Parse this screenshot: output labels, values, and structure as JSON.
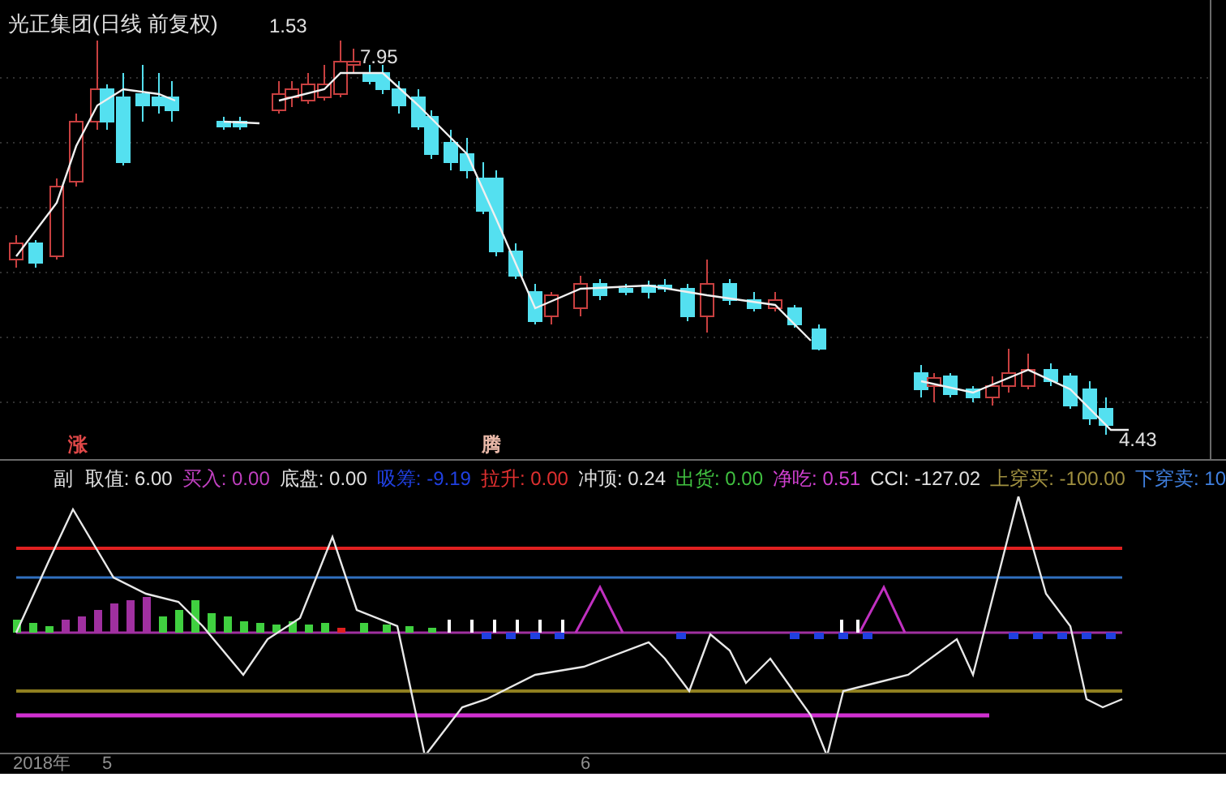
{
  "chart_title": "光正集团(日线 前复权)",
  "price_reading": "1.53",
  "high_label": "7.95",
  "low_label": "4.43",
  "markers": [
    {
      "text": "涨",
      "color": "#e04848"
    },
    {
      "text": "腾",
      "color": "#e8b8a8"
    }
  ],
  "indicator": {
    "name": "副",
    "readings": [
      {
        "text": "取值: 6.00",
        "color": "#e0e0e0"
      },
      {
        "text": "买入: 0.00",
        "color": "#c040c0"
      },
      {
        "text": "底盘: 0.00",
        "color": "#e0e0e0"
      },
      {
        "text": "吸筹: -9.19",
        "color": "#2040e0"
      },
      {
        "text": "拉升: 0.00",
        "color": "#e03030"
      },
      {
        "text": "冲顶: 0.24",
        "color": "#e0e0e0"
      },
      {
        "text": "出货: 0.00",
        "color": "#40c040"
      },
      {
        "text": "净吃: 0.51",
        "color": "#d040d0"
      },
      {
        "text": "CCI: -127.02",
        "color": "#e0e0e0"
      },
      {
        "text": "上穿买: -100.00",
        "color": "#a09040"
      },
      {
        "text": "下穿卖: 10",
        "color": "#4080e0"
      }
    ]
  },
  "time_axis": [
    "2018年",
    "5",
    "6"
  ]
}
